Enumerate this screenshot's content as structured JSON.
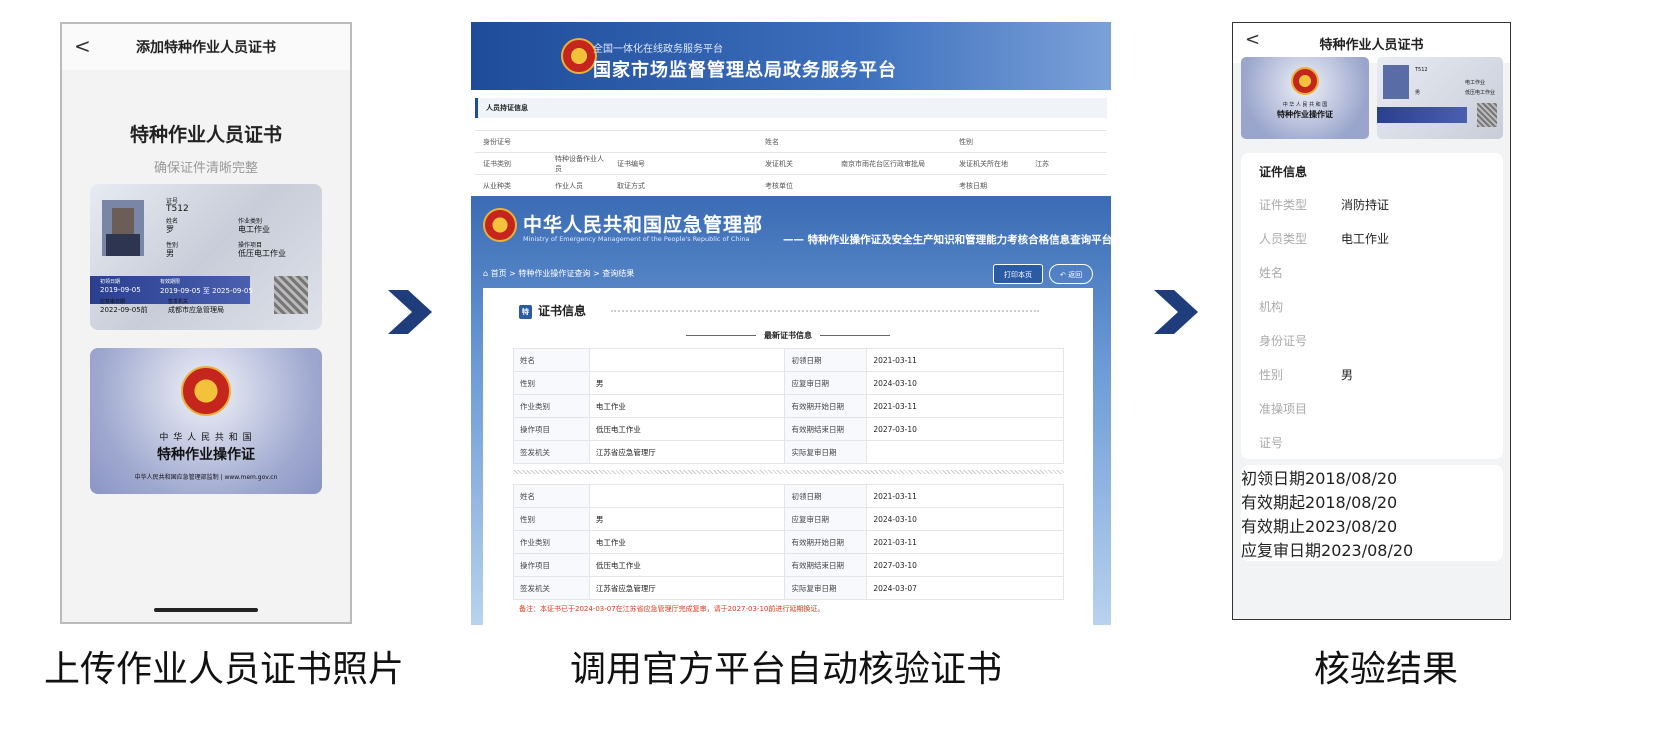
{
  "captions": [
    "上传作业人员证书照片",
    "调用官方平台自动核验证书",
    "核验结果"
  ],
  "phone1": {
    "back": "<",
    "nav_title": "添加特种作业人员证书",
    "title": "特种作业人员证书",
    "subtitle": "确保证件清晰完整",
    "front": {
      "no_label": "证号",
      "no_value": "T512",
      "name_label": "姓名",
      "name_value": "罗",
      "type_label": "作业类别",
      "type_value": "电工作业",
      "sex_label": "性别",
      "sex_value": "男",
      "item_label": "操作项目",
      "item_value": "低压电工作业",
      "first_label": "初领日期",
      "first_value": "2019-09-05",
      "valid_label": "有效期限",
      "valid_value": "2019-09-05 至 2025-09-05",
      "review_label": "应复审日期",
      "review_value": "2022-09-05前",
      "issuer_label": "签发机关",
      "issuer_value": "成都市应急管理局"
    },
    "back_card": {
      "country": "中 华 人 民 共 和 国",
      "name": "特种作业操作证",
      "footer": "中华人民共和国应急管理部监制 | www.mem.gov.cn"
    }
  },
  "web": {
    "top_small": "全国一体化在线政务服务平台",
    "top_big": "国家市场监督管理总局政务服务平台",
    "section": "人员持证信息",
    "samr_rows": [
      [
        "身份证号",
        "",
        "姓名",
        "",
        "性别",
        ""
      ],
      [
        "证书类别",
        "特种设备作业人员",
        "证书编号",
        "",
        "发证机关",
        "南京市雨花台区行政审批局",
        "发证机关所在地",
        "江苏"
      ],
      [
        "从业种类",
        "作业人员",
        "取证方式",
        "",
        "考核单位",
        "",
        "考核日期",
        ""
      ]
    ],
    "em_title": "中华人民共和国应急管理部",
    "em_eng": "Ministry of Emergency Management of the People's Republic of China",
    "em_right": "—— 特种作业操作证及安全生产知识和管理能力考核合格信息查询平台",
    "crumb": "首页 > 特种作业操作证查询 > 查询结果",
    "print_btn": "打印本页",
    "back_btn": "返回",
    "tag": "特",
    "cert_title": "证书信息",
    "latest": "最新证书信息",
    "table1": [
      [
        "姓名",
        "",
        "初领日期",
        "2021-03-11"
      ],
      [
        "性别",
        "男",
        "应复审日期",
        "2024-03-10"
      ],
      [
        "作业类别",
        "电工作业",
        "有效期开始日期",
        "2021-03-11"
      ],
      [
        "操作项目",
        "低压电工作业",
        "有效期结束日期",
        "2027-03-10"
      ],
      [
        "签发机关",
        "江苏省应急管理厅",
        "实际复审日期",
        ""
      ]
    ],
    "table2": [
      [
        "姓名",
        "",
        "初领日期",
        "2021-03-11"
      ],
      [
        "性别",
        "男",
        "应复审日期",
        "2024-03-10"
      ],
      [
        "作业类别",
        "电工作业",
        "有效期开始日期",
        "2021-03-11"
      ],
      [
        "操作项目",
        "低压电工作业",
        "有效期结束日期",
        "2027-03-10"
      ],
      [
        "签发机关",
        "江苏省应急管理厅",
        "实际复审日期",
        "2024-03-07"
      ]
    ],
    "note": "备注：本证书已于2024-03-07在江苏省应急管理厅完成复审，请于2027-03-10前进行延期换证。"
  },
  "phone3": {
    "back": "<",
    "nav_title": "特种作业人员证书",
    "thumb_country": "中 华 人 民 共 和 国",
    "thumb_name": "特种作业操作证",
    "thumb_no": "T512",
    "thumb_type": "电工作业",
    "thumb_sex": "男",
    "thumb_item": "低压电工作业",
    "section": "证件信息",
    "rows": [
      [
        "证件类型",
        "消防持证"
      ],
      [
        "人员类型",
        "电工作业"
      ],
      [
        "姓名",
        ""
      ],
      [
        "机构",
        ""
      ],
      [
        "身份证号",
        ""
      ],
      [
        "性别",
        "男"
      ],
      [
        "准操项目",
        ""
      ],
      [
        "证号",
        ""
      ]
    ],
    "rows2": [
      [
        "初领日期",
        "2018/08/20"
      ],
      [
        "有效期起",
        "2018/08/20"
      ],
      [
        "有效期止",
        "2023/08/20"
      ],
      [
        "应复审日期",
        "2023/08/20"
      ]
    ]
  },
  "colors": {
    "arrow": "#1f3d7a",
    "web_blue": "#1f4c9a",
    "note_red": "#d93a1c"
  }
}
